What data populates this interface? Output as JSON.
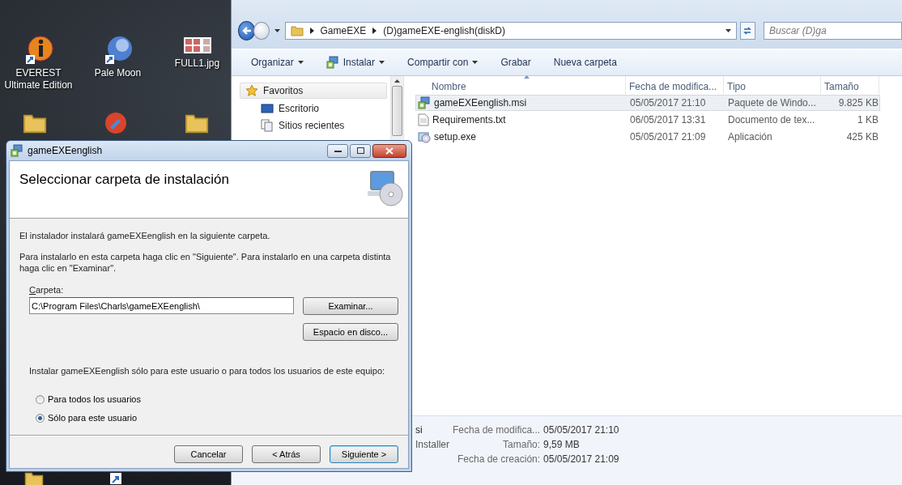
{
  "desktop_icons": [
    {
      "kind": "info",
      "label": "EVEREST Ultimate Edition"
    },
    {
      "kind": "globe",
      "label": "Pale Moon"
    },
    {
      "kind": "image",
      "label": "FULL1.jpg"
    }
  ],
  "explorer": {
    "breadcrumb": [
      "GameEXE",
      "(D)gameEXE-english(diskD)"
    ],
    "search": {
      "placeholder": "Buscar (D)ga"
    },
    "toolbar": [
      {
        "label": "Organizar",
        "kind": "plain",
        "dropdown": true
      },
      {
        "label": "Instalar",
        "kind": "install",
        "dropdown": true
      },
      {
        "label": "Compartir con",
        "kind": "plain",
        "dropdown": true
      },
      {
        "label": "Grabar",
        "kind": "plain",
        "dropdown": false
      },
      {
        "label": "Nueva carpeta",
        "kind": "plain",
        "dropdown": false
      }
    ],
    "nav": [
      {
        "label": "Favoritos",
        "kind": "star",
        "selected": true
      },
      {
        "label": "Escritorio",
        "kind": "desktop",
        "selected": false
      },
      {
        "label": "Sitios recientes",
        "kind": "recent",
        "selected": false
      }
    ],
    "columns": [
      {
        "label": "Nombre",
        "sorted": true
      },
      {
        "label": "Fecha de modifica...",
        "sorted": false
      },
      {
        "label": "Tipo",
        "sorted": false
      },
      {
        "label": "Tamaño",
        "sorted": false
      }
    ],
    "files": [
      {
        "kind": "msi",
        "name": "gameEXEenglish.msi",
        "date": "05/05/2017 21:10",
        "type": "Paquete de Windo...",
        "size": "9.825 KB",
        "selected": true
      },
      {
        "kind": "txt",
        "name": "Requirements.txt",
        "date": "06/05/2017 13:31",
        "type": "Documento de tex...",
        "size": "1 KB",
        "selected": false
      },
      {
        "kind": "exe",
        "name": "setup.exe",
        "date": "05/05/2017 21:09",
        "type": "Aplicación",
        "size": "425 KB",
        "selected": false
      }
    ],
    "details": {
      "name_fragment": "si",
      "type_fragment": "Installer",
      "properties": [
        {
          "label": "Fecha de modifica...",
          "value": "05/05/2017 21:10"
        },
        {
          "label": "Tamaño:",
          "value": "9,59 MB"
        },
        {
          "label": "Fecha de creación:",
          "value": "05/05/2017 21:09"
        }
      ]
    }
  },
  "dialog": {
    "title": "gameEXEenglish",
    "heading": "Seleccionar carpeta de instalación",
    "intro": "El instalador instalará gameEXEenglish en la siguiente carpeta.",
    "instructions": "Para instalarlo en esta carpeta haga clic en \"Siguiente\". Para instalarlo en una carpeta distinta haga clic en \"Examinar\".",
    "folder_label": "Carpeta:",
    "folder_value": "C:\\Program Files\\Charls\\gameEXEenglish\\",
    "browse_button": "Examinar...",
    "disk_button": "Espacio en disco...",
    "question": "Instalar gameEXEenglish sólo para este usuario o para todos los usuarios de este equipo:",
    "options": [
      {
        "label": "Para todos los usuarios",
        "selected": false
      },
      {
        "label": "Sólo para este usuario",
        "selected": true
      }
    ],
    "buttons": [
      {
        "label": "Cancelar",
        "default": false
      },
      {
        "label": "< Atrás",
        "default": false
      },
      {
        "label": "Siguiente >",
        "default": true
      }
    ]
  }
}
